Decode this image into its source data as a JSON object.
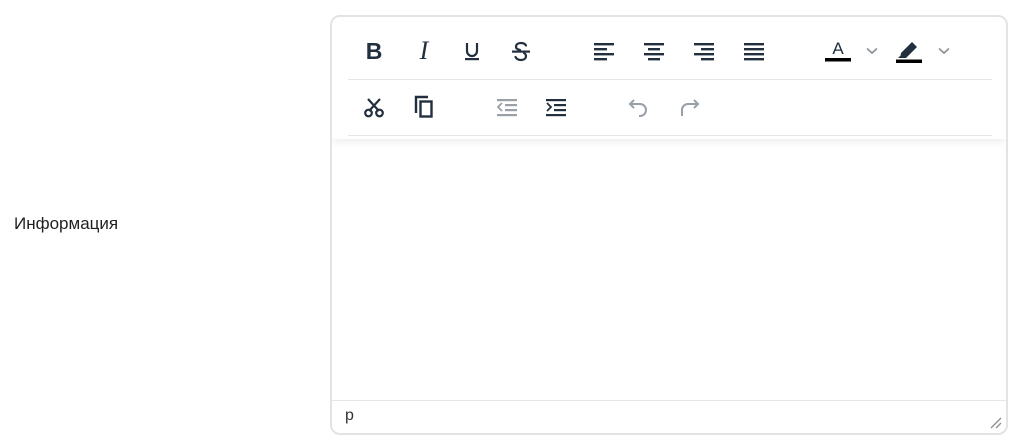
{
  "field": {
    "label": "Информация"
  },
  "toolbar": {
    "row1": [
      {
        "name": "bold",
        "glyph": "B"
      },
      {
        "name": "italic",
        "glyph": "I"
      },
      {
        "name": "underline",
        "icon": "underline-icon"
      },
      {
        "name": "strikethrough",
        "icon": "strikethrough-icon"
      },
      {
        "name": "align-left",
        "icon": "align-left-icon"
      },
      {
        "name": "align-center",
        "icon": "align-center-icon"
      },
      {
        "name": "align-right",
        "icon": "align-right-icon"
      },
      {
        "name": "align-justify",
        "icon": "align-justify-icon"
      },
      {
        "name": "text-color",
        "icon": "text-color-icon"
      },
      {
        "name": "highlight-color",
        "icon": "highlighter-icon"
      }
    ],
    "row2": [
      {
        "name": "cut",
        "icon": "scissors-icon"
      },
      {
        "name": "copy",
        "icon": "copy-icon"
      },
      {
        "name": "outdent",
        "icon": "outdent-icon",
        "disabled": true
      },
      {
        "name": "indent",
        "icon": "indent-icon"
      },
      {
        "name": "undo",
        "icon": "undo-icon",
        "disabled": true
      },
      {
        "name": "redo",
        "icon": "redo-icon",
        "disabled": true
      }
    ],
    "bold_glyph": "B",
    "italic_glyph": "I",
    "text_color_letter": "A",
    "text_color_swatch": "#000000",
    "highlight_swatch": "#000000"
  },
  "statusbar": {
    "path": "p"
  },
  "colors": {
    "icon": "#222f3e",
    "border": "#e3e3e3"
  }
}
